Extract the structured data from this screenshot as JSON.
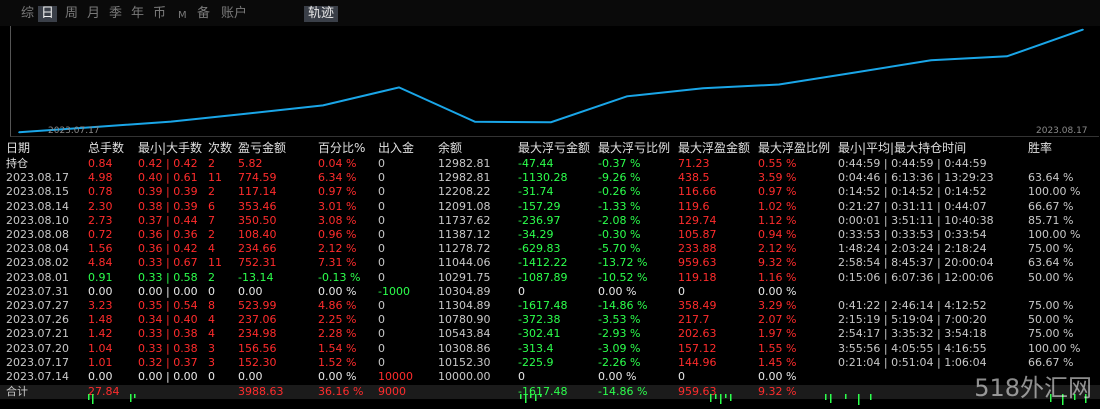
{
  "tabs": [
    {
      "label": "综",
      "active": false,
      "small": false
    },
    {
      "label": "日",
      "active": true,
      "small": false
    },
    {
      "label": "周",
      "active": false,
      "small": false
    },
    {
      "label": "月",
      "active": false,
      "small": false
    },
    {
      "label": "季",
      "active": false,
      "small": false
    },
    {
      "label": "年",
      "active": false,
      "small": false
    },
    {
      "label": "币",
      "active": false,
      "small": false
    },
    {
      "label": "M",
      "active": false,
      "small": true
    },
    {
      "label": "备",
      "active": false,
      "small": false
    },
    {
      "label": "账户",
      "active": false,
      "small": false
    }
  ],
  "track_button": "轨迹",
  "chart_data": {
    "type": "line",
    "x": [
      "2023.07.14",
      "2023.07.17",
      "2023.07.20",
      "2023.07.21",
      "2023.07.26",
      "2023.07.27",
      "2023.07.31",
      "2023.08.01",
      "2023.08.02",
      "2023.08.04",
      "2023.08.08",
      "2023.08.10",
      "2023.08.14",
      "2023.08.15",
      "2023.08.17"
    ],
    "values": [
      10000,
      10152.3,
      10308.86,
      10543.84,
      10780.9,
      11304.89,
      10304.89,
      10291.75,
      11044.06,
      11278.72,
      11387.12,
      11737.62,
      12091.08,
      12208.22,
      12982.81
    ],
    "x_start_label": "2023.07.17",
    "x_end_label": "2023.08.17",
    "color": "#1aa6e8"
  },
  "headers": [
    "日期",
    "总手数",
    "最小|大手数",
    "次数",
    "盈亏金额",
    "百分比%",
    "出入金",
    "余额",
    "最大浮亏金额",
    "最大浮亏比例",
    "最大浮盈金额",
    "最大浮盈比例",
    "最小|平均|最大持仓时间",
    "胜率"
  ],
  "rows": [
    [
      "持仓",
      "0.84",
      "0.42 | 0.42",
      "2",
      "5.82",
      "0.04 %",
      "0",
      "12982.81",
      "-47.44",
      "-0.37 %",
      "71.23",
      "0.55 %",
      "0:44:59 | 0:44:59 | 0:44:59",
      ""
    ],
    [
      "2023.08.17",
      "4.98",
      "0.40 | 0.61",
      "11",
      "774.59",
      "6.34 %",
      "0",
      "12982.81",
      "-1130.28",
      "-9.26 %",
      "438.5",
      "3.59 %",
      "0:04:46 | 6:13:36 | 13:29:23",
      "63.64 %"
    ],
    [
      "2023.08.15",
      "0.78",
      "0.39 | 0.39",
      "2",
      "117.14",
      "0.97 %",
      "0",
      "12208.22",
      "-31.74",
      "-0.26 %",
      "116.66",
      "0.97 %",
      "0:14:52 | 0:14:52 | 0:14:52",
      "100.00 %"
    ],
    [
      "2023.08.14",
      "2.30",
      "0.38 | 0.39",
      "6",
      "353.46",
      "3.01 %",
      "0",
      "12091.08",
      "-157.29",
      "-1.33 %",
      "119.6",
      "1.02 %",
      "0:21:27 | 0:31:11 | 0:44:07",
      "66.67 %"
    ],
    [
      "2023.08.10",
      "2.73",
      "0.37 | 0.44",
      "7",
      "350.50",
      "3.08 %",
      "0",
      "11737.62",
      "-236.97",
      "-2.08 %",
      "129.74",
      "1.12 %",
      "0:00:01 | 3:51:11 | 10:40:38",
      "85.71 %"
    ],
    [
      "2023.08.08",
      "0.72",
      "0.36 | 0.36",
      "2",
      "108.40",
      "0.96 %",
      "0",
      "11387.12",
      "-34.29",
      "-0.30 %",
      "105.87",
      "0.94 %",
      "0:33:53 | 0:33:53 | 0:33:54",
      "100.00 %"
    ],
    [
      "2023.08.04",
      "1.56",
      "0.36 | 0.42",
      "4",
      "234.66",
      "2.12 %",
      "0",
      "11278.72",
      "-629.83",
      "-5.70 %",
      "233.88",
      "2.12 %",
      "1:48:24 | 2:03:24 | 2:18:24",
      "75.00 %"
    ],
    [
      "2023.08.02",
      "4.84",
      "0.33 | 0.67",
      "11",
      "752.31",
      "7.31 %",
      "0",
      "11044.06",
      "-1412.22",
      "-13.72 %",
      "959.63",
      "9.32 %",
      "2:58:54 | 8:45:37 | 20:00:04",
      "63.64 %"
    ],
    [
      "2023.08.01",
      "0.91",
      "0.33 | 0.58",
      "2",
      "-13.14",
      "-0.13 %",
      "0",
      "10291.75",
      "-1087.89",
      "-10.52 %",
      "119.18",
      "1.16 %",
      "0:15:06 | 6:07:36 | 12:00:06",
      "50.00 %"
    ],
    [
      "2023.07.31",
      "0.00",
      "0.00 | 0.00",
      "0",
      "0.00",
      "0.00 %",
      "-1000",
      "10304.89",
      "0",
      "0.00 %",
      "0",
      "0.00 %",
      "",
      ""
    ],
    [
      "2023.07.27",
      "3.23",
      "0.35 | 0.54",
      "8",
      "523.99",
      "4.86 %",
      "0",
      "11304.89",
      "-1617.48",
      "-14.86 %",
      "358.49",
      "3.29 %",
      "0:41:22 | 2:46:14 | 4:12:52",
      "75.00 %"
    ],
    [
      "2023.07.26",
      "1.48",
      "0.34 | 0.40",
      "4",
      "237.06",
      "2.25 %",
      "0",
      "10780.90",
      "-372.38",
      "-3.53 %",
      "217.7",
      "2.07 %",
      "2:15:19 | 5:19:04 | 7:00:20",
      "50.00 %"
    ],
    [
      "2023.07.21",
      "1.42",
      "0.33 | 0.38",
      "4",
      "234.98",
      "2.28 %",
      "0",
      "10543.84",
      "-302.41",
      "-2.93 %",
      "202.63",
      "1.97 %",
      "2:54:17 | 3:35:32 | 3:54:18",
      "75.00 %"
    ],
    [
      "2023.07.20",
      "1.04",
      "0.33 | 0.38",
      "3",
      "156.56",
      "1.54 %",
      "0",
      "10308.86",
      "-313.4",
      "-3.09 %",
      "157.12",
      "1.55 %",
      "3:55:56 | 4:05:55 | 4:16:55",
      "100.00 %"
    ],
    [
      "2023.07.17",
      "1.01",
      "0.32 | 0.37",
      "3",
      "152.30",
      "1.52 %",
      "0",
      "10152.30",
      "-225.9",
      "-2.26 %",
      "144.96",
      "1.45 %",
      "0:21:04 | 0:51:04 | 1:06:04",
      "66.67 %"
    ],
    [
      "2023.07.14",
      "0.00",
      "0.00 | 0.00",
      "0",
      "0.00",
      "0.00 %",
      "10000",
      "10000.00",
      "0",
      "0.00 %",
      "0",
      "0.00 %",
      "",
      ""
    ]
  ],
  "total": [
    "合计",
    "27.84",
    "",
    "",
    "3988.63",
    "36.16 %",
    "9000",
    "",
    "-1617.48",
    "-14.86 %",
    "959.63",
    "9.32 %",
    "",
    ""
  ],
  "watermark": "518外汇网",
  "colors": {
    "profit": "#ff2c2c",
    "loss": "#2cff4c",
    "line": "#1aa6e8"
  }
}
